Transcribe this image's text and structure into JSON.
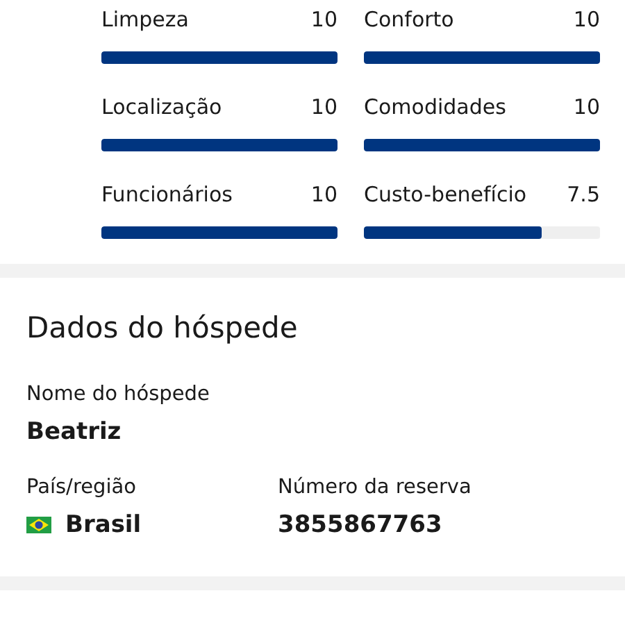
{
  "ratings": [
    {
      "label": "Limpeza",
      "score": "10",
      "level": 1
    },
    {
      "label": "Conforto",
      "score": "10",
      "level": 1
    },
    {
      "label": "Localização",
      "score": "10",
      "level": 1
    },
    {
      "label": "Comodidades",
      "score": "10",
      "level": 1
    },
    {
      "label": "Funcionários",
      "score": "10",
      "level": 1
    },
    {
      "label": "Custo-benefício",
      "score": "7.5",
      "level": 0.75
    }
  ],
  "guest": {
    "title": "Dados do hóspede",
    "fields": [
      {
        "label": "Nome do hóspede",
        "value": "Beatriz",
        "kind": "text"
      },
      {
        "label": "País/região",
        "value": "Brasil",
        "kind": "country"
      },
      {
        "label": "Número da reserva",
        "value": "3855867763",
        "kind": "text"
      }
    ]
  }
}
